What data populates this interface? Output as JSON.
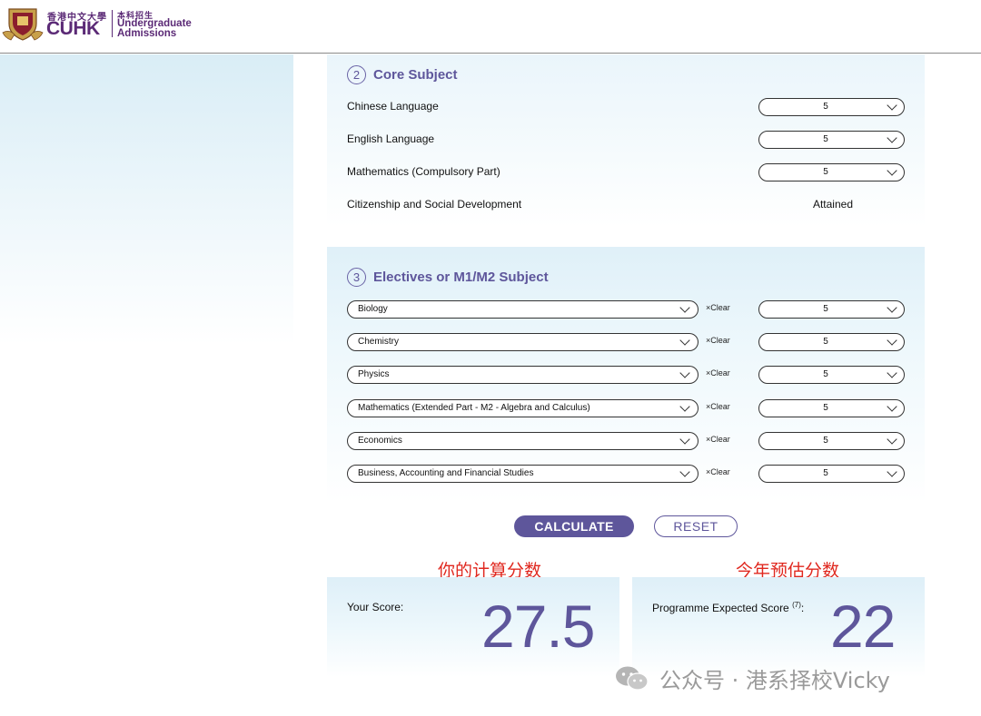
{
  "header": {
    "logo_chinese": "香港中文大學",
    "logo_short": "CUHK",
    "logo_chinese_dept": "本科招生",
    "logo_dept_line1": "Undergraduate",
    "logo_dept_line2": "Admissions"
  },
  "core": {
    "number": "2",
    "title": "Core Subject",
    "rows": [
      {
        "label": "Chinese Language",
        "grade": "5"
      },
      {
        "label": "English Language",
        "grade": "5"
      },
      {
        "label": "Mathematics (Compulsory Part)",
        "grade": "5"
      },
      {
        "label": "Citizenship and Social Development",
        "status": "Attained"
      }
    ]
  },
  "electives": {
    "number": "3",
    "title": "Electives or M1/M2 Subject",
    "clear_label": "×Clear",
    "rows": [
      {
        "subject": "Biology",
        "grade": "5"
      },
      {
        "subject": "Chemistry",
        "grade": "5"
      },
      {
        "subject": "Physics",
        "grade": "5"
      },
      {
        "subject": "Mathematics (Extended Part - M2 - Algebra and Calculus)",
        "grade": "5"
      },
      {
        "subject": "Economics",
        "grade": "5"
      },
      {
        "subject": "Business, Accounting and Financial Studies",
        "grade": "5"
      }
    ]
  },
  "actions": {
    "calculate": "CALCULATE",
    "reset": "RESET"
  },
  "annotations": {
    "your_score": "你的计算分数",
    "expected_score": "今年预估分数"
  },
  "results": {
    "your_score_label": "Your Score:",
    "your_score_value": "27.5",
    "expected_label": "Programme Expected Score",
    "expected_note": "(7)",
    "expected_colon": ":",
    "expected_value": "22"
  },
  "watermark": {
    "text": "公众号 · 港系择校Vicky"
  },
  "colors": {
    "brand_purple": "#5b2a76",
    "accent": "#5e569b",
    "annotation_red": "#e0281f"
  }
}
